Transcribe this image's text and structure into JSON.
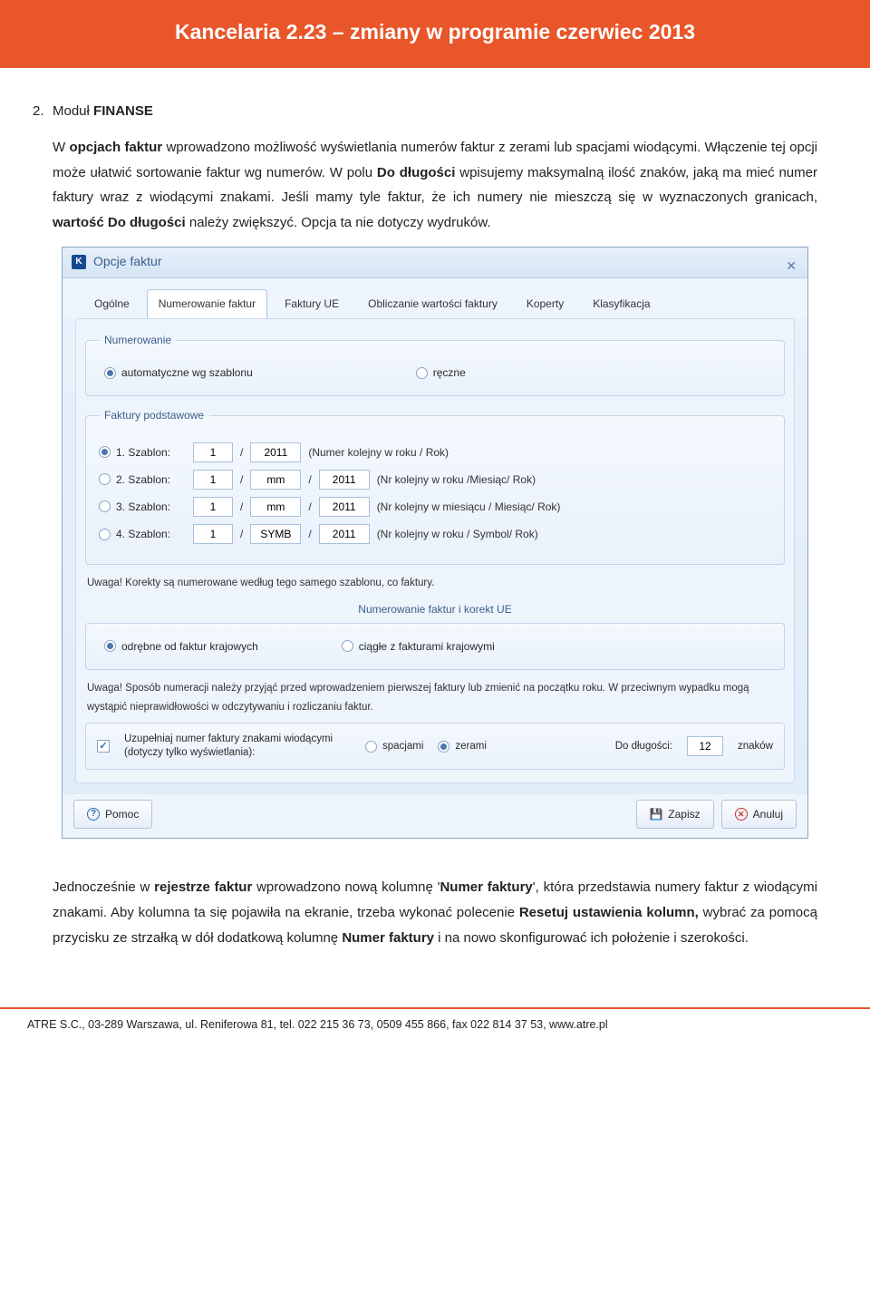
{
  "header": {
    "title": "Kancelaria 2.23 – zmiany w programie czerwiec 2013"
  },
  "doc": {
    "section_num": "2.",
    "section_lead": "Moduł ",
    "section_lead_bold": "FINANSE",
    "p1a": "W ",
    "p1b": "opcjach faktur",
    "p1c": " wprowadzono możliwość wyświetlania numerów faktur z zerami lub spacjami wiodącymi. Włączenie tej opcji  może ułatwić sortowanie faktur wg numerów. W polu ",
    "p1d": "Do długości",
    "p1e": " wpisujemy maksymalną ilość znaków, jaką ma mieć numer faktury wraz z wiodącymi znakami. Jeśli mamy tyle faktur, że ich numery   nie mieszczą się w wyznaczonych granicach, ",
    "p1f": "wartość Do długości",
    "p1g": " należy zwiększyć.  Opcja ta nie dotyczy wydruków.",
    "p2a": "Jednocześnie w ",
    "p2b": "rejestrze faktur",
    "p2c": " wprowadzono nową kolumnę '",
    "p2d": "Numer faktury",
    "p2e": "', która przedstawia  numery faktur z wiodącymi znakami. Aby kolumna ta się pojawiła na ekranie, trzeba wykonać polecenie ",
    "p2f": "Resetuj ustawienia kolumn,",
    "p2g": " wybrać za pomocą przycisku ze strzałką w dół dodatkową kolumnę ",
    "p2h": "Numer faktury",
    "p2i": " i na nowo skonfigurować ich położenie i szerokości."
  },
  "win": {
    "title": "Opcje faktur",
    "tabs": [
      "Ogólne",
      "Numerowanie faktur",
      "Faktury UE",
      "Obliczanie wartości faktury",
      "Koperty",
      "Klasyfikacja"
    ],
    "fs1_legend": "Numerowanie",
    "r_auto": "automatyczne wg szablonu",
    "r_manual": "ręczne",
    "fs2_legend": "Faktury podstawowe",
    "templates": [
      {
        "label": "1. Szablon:",
        "f1": "1",
        "f2": "2011",
        "f3": "",
        "desc": "(Numer kolejny w roku / Rok)"
      },
      {
        "label": "2. Szablon:",
        "f1": "1",
        "f2": "mm",
        "f3": "2011",
        "desc": "(Nr kolejny w roku /Miesiąc/ Rok)"
      },
      {
        "label": "3. Szablon:",
        "f1": "1",
        "f2": "mm",
        "f3": "2011",
        "desc": "(Nr kolejny w miesiącu / Miesiąc/ Rok)"
      },
      {
        "label": "4. Szablon:",
        "f1": "1",
        "f2": "SYMB",
        "f3": "2011",
        "desc": "(Nr kolejny w roku / Symbol/ Rok)"
      }
    ],
    "warn1": "Uwaga! Korekty są numerowane według tego samego szablonu, co faktury.",
    "sub_legend": "Numerowanie faktur i korekt UE",
    "r_sep": "odrębne od faktur krajowych",
    "r_cont": "ciągłe z fakturami krajowymi",
    "warn2": "Uwaga! Sposób numeracji należy przyjąć przed wprowadzeniem pierwszej faktury lub zmienić na początku roku. W przeciwnym wypadku mogą wystąpić nieprawidłowości w odczytywaniu i rozliczaniu faktur.",
    "fill_label": "Uzupełniaj numer faktury znakami wiodącymi (dotyczy tylko wyświetlania):",
    "fill_spaces": "spacjami",
    "fill_zeros": "zerami",
    "len_label": "Do długości:",
    "len_value": "12",
    "len_unit": "znaków",
    "btn_help": "Pomoc",
    "btn_save": "Zapisz",
    "btn_cancel": "Anuluj"
  },
  "footer": {
    "text": "ATRE S.C., 03-289 Warszawa, ul. Reniferowa 81, tel. 022 215 36 73, 0509 455 866, fax 022 814 37 53, www.atre.pl"
  }
}
